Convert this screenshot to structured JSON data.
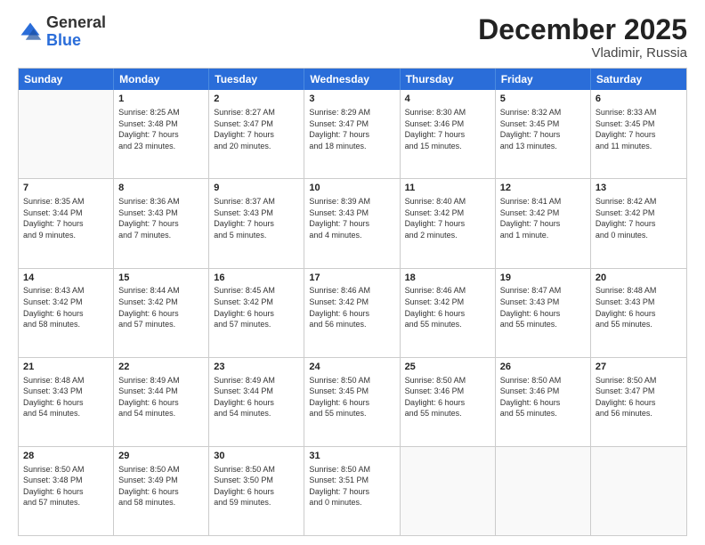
{
  "header": {
    "logo": {
      "general": "General",
      "blue": "Blue"
    },
    "title": "December 2025",
    "location": "Vladimir, Russia"
  },
  "weekdays": [
    "Sunday",
    "Monday",
    "Tuesday",
    "Wednesday",
    "Thursday",
    "Friday",
    "Saturday"
  ],
  "rows": [
    [
      {
        "day": "",
        "info": ""
      },
      {
        "day": "1",
        "info": "Sunrise: 8:25 AM\nSunset: 3:48 PM\nDaylight: 7 hours\nand 23 minutes."
      },
      {
        "day": "2",
        "info": "Sunrise: 8:27 AM\nSunset: 3:47 PM\nDaylight: 7 hours\nand 20 minutes."
      },
      {
        "day": "3",
        "info": "Sunrise: 8:29 AM\nSunset: 3:47 PM\nDaylight: 7 hours\nand 18 minutes."
      },
      {
        "day": "4",
        "info": "Sunrise: 8:30 AM\nSunset: 3:46 PM\nDaylight: 7 hours\nand 15 minutes."
      },
      {
        "day": "5",
        "info": "Sunrise: 8:32 AM\nSunset: 3:45 PM\nDaylight: 7 hours\nand 13 minutes."
      },
      {
        "day": "6",
        "info": "Sunrise: 8:33 AM\nSunset: 3:45 PM\nDaylight: 7 hours\nand 11 minutes."
      }
    ],
    [
      {
        "day": "7",
        "info": "Sunrise: 8:35 AM\nSunset: 3:44 PM\nDaylight: 7 hours\nand 9 minutes."
      },
      {
        "day": "8",
        "info": "Sunrise: 8:36 AM\nSunset: 3:43 PM\nDaylight: 7 hours\nand 7 minutes."
      },
      {
        "day": "9",
        "info": "Sunrise: 8:37 AM\nSunset: 3:43 PM\nDaylight: 7 hours\nand 5 minutes."
      },
      {
        "day": "10",
        "info": "Sunrise: 8:39 AM\nSunset: 3:43 PM\nDaylight: 7 hours\nand 4 minutes."
      },
      {
        "day": "11",
        "info": "Sunrise: 8:40 AM\nSunset: 3:42 PM\nDaylight: 7 hours\nand 2 minutes."
      },
      {
        "day": "12",
        "info": "Sunrise: 8:41 AM\nSunset: 3:42 PM\nDaylight: 7 hours\nand 1 minute."
      },
      {
        "day": "13",
        "info": "Sunrise: 8:42 AM\nSunset: 3:42 PM\nDaylight: 7 hours\nand 0 minutes."
      }
    ],
    [
      {
        "day": "14",
        "info": "Sunrise: 8:43 AM\nSunset: 3:42 PM\nDaylight: 6 hours\nand 58 minutes."
      },
      {
        "day": "15",
        "info": "Sunrise: 8:44 AM\nSunset: 3:42 PM\nDaylight: 6 hours\nand 57 minutes."
      },
      {
        "day": "16",
        "info": "Sunrise: 8:45 AM\nSunset: 3:42 PM\nDaylight: 6 hours\nand 57 minutes."
      },
      {
        "day": "17",
        "info": "Sunrise: 8:46 AM\nSunset: 3:42 PM\nDaylight: 6 hours\nand 56 minutes."
      },
      {
        "day": "18",
        "info": "Sunrise: 8:46 AM\nSunset: 3:42 PM\nDaylight: 6 hours\nand 55 minutes."
      },
      {
        "day": "19",
        "info": "Sunrise: 8:47 AM\nSunset: 3:43 PM\nDaylight: 6 hours\nand 55 minutes."
      },
      {
        "day": "20",
        "info": "Sunrise: 8:48 AM\nSunset: 3:43 PM\nDaylight: 6 hours\nand 55 minutes."
      }
    ],
    [
      {
        "day": "21",
        "info": "Sunrise: 8:48 AM\nSunset: 3:43 PM\nDaylight: 6 hours\nand 54 minutes."
      },
      {
        "day": "22",
        "info": "Sunrise: 8:49 AM\nSunset: 3:44 PM\nDaylight: 6 hours\nand 54 minutes."
      },
      {
        "day": "23",
        "info": "Sunrise: 8:49 AM\nSunset: 3:44 PM\nDaylight: 6 hours\nand 54 minutes."
      },
      {
        "day": "24",
        "info": "Sunrise: 8:50 AM\nSunset: 3:45 PM\nDaylight: 6 hours\nand 55 minutes."
      },
      {
        "day": "25",
        "info": "Sunrise: 8:50 AM\nSunset: 3:46 PM\nDaylight: 6 hours\nand 55 minutes."
      },
      {
        "day": "26",
        "info": "Sunrise: 8:50 AM\nSunset: 3:46 PM\nDaylight: 6 hours\nand 55 minutes."
      },
      {
        "day": "27",
        "info": "Sunrise: 8:50 AM\nSunset: 3:47 PM\nDaylight: 6 hours\nand 56 minutes."
      }
    ],
    [
      {
        "day": "28",
        "info": "Sunrise: 8:50 AM\nSunset: 3:48 PM\nDaylight: 6 hours\nand 57 minutes."
      },
      {
        "day": "29",
        "info": "Sunrise: 8:50 AM\nSunset: 3:49 PM\nDaylight: 6 hours\nand 58 minutes."
      },
      {
        "day": "30",
        "info": "Sunrise: 8:50 AM\nSunset: 3:50 PM\nDaylight: 6 hours\nand 59 minutes."
      },
      {
        "day": "31",
        "info": "Sunrise: 8:50 AM\nSunset: 3:51 PM\nDaylight: 7 hours\nand 0 minutes."
      },
      {
        "day": "",
        "info": ""
      },
      {
        "day": "",
        "info": ""
      },
      {
        "day": "",
        "info": ""
      }
    ]
  ]
}
